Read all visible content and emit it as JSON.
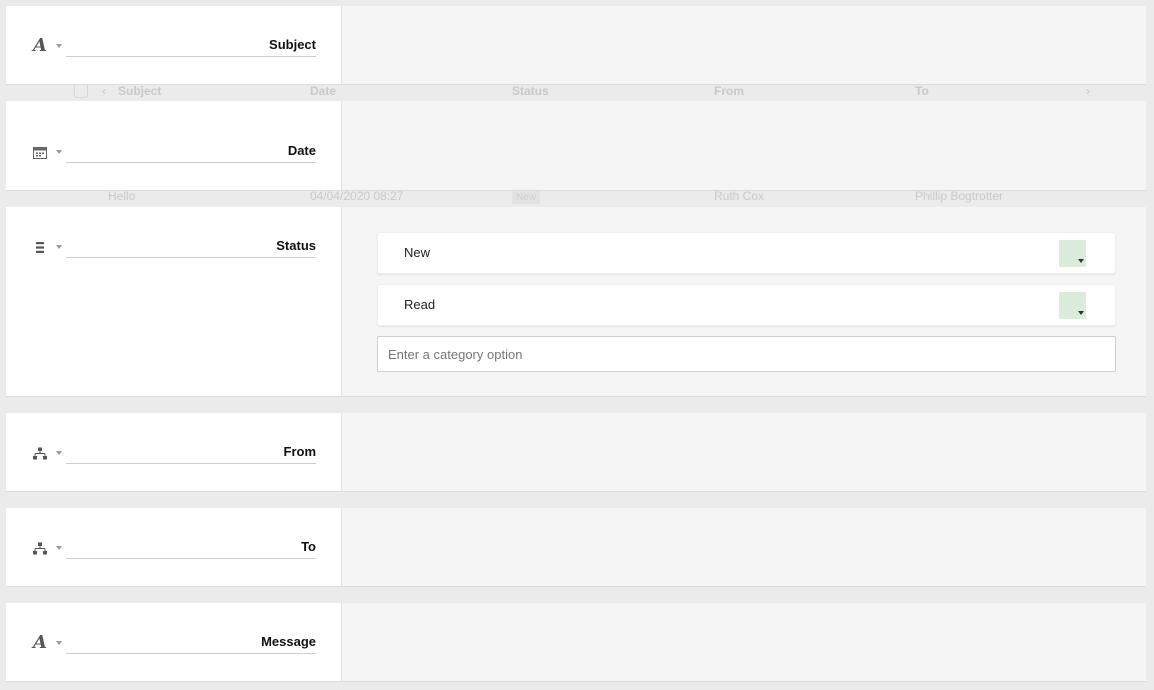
{
  "background_grid": {
    "headers": [
      "Subject",
      "Date",
      "Status",
      "From",
      "To"
    ],
    "row": {
      "subject": "Hello",
      "date": "04/04/2020 08:27",
      "status": "New",
      "from": "Ruth Cox",
      "to": "Phillip Bogtrotter"
    }
  },
  "fields": [
    {
      "name": "Subject",
      "icon": "text-type-icon"
    },
    {
      "name": "Date",
      "icon": "calendar-icon"
    },
    {
      "name": "Status",
      "icon": "list-icon"
    },
    {
      "name": "From",
      "icon": "link-row-icon"
    },
    {
      "name": "To",
      "icon": "link-row-icon"
    },
    {
      "name": "Message",
      "icon": "text-type-icon"
    }
  ],
  "status_options": [
    {
      "label": "New",
      "color": "#dcecdc"
    },
    {
      "label": "Read",
      "color": "#dcecdc"
    }
  ],
  "category_input": {
    "value": "",
    "placeholder": "Enter a category option"
  },
  "colors": {
    "panel_bg": "#f5f5f5",
    "page_bg": "#ebebeb",
    "swatch_green": "#dcecdc"
  }
}
